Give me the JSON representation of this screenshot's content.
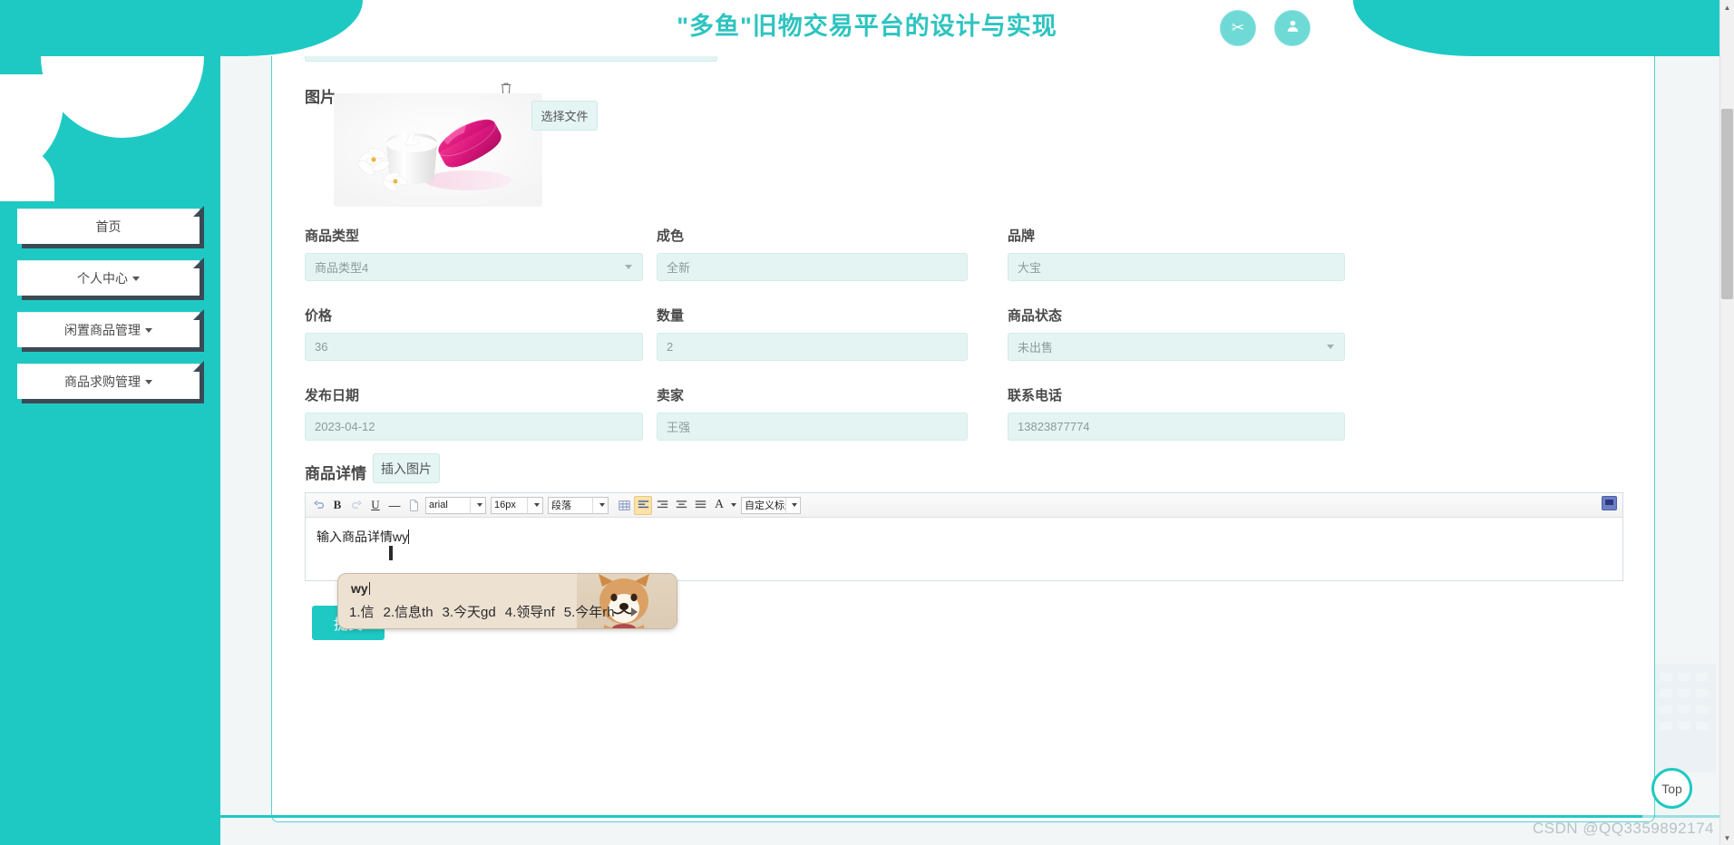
{
  "header": {
    "title": "\"多鱼\"旧物交易平台的设计与实现",
    "share_icon": "✂",
    "user_icon": "👤",
    "accent_color": "#1fc9c3"
  },
  "sidebar": {
    "items": [
      {
        "label": "首页",
        "has_caret": false
      },
      {
        "label": "个人中心",
        "has_caret": true
      },
      {
        "label": "闲置商品管理",
        "has_caret": true
      },
      {
        "label": "商品求购管理",
        "has_caret": true
      }
    ]
  },
  "form": {
    "image_section": {
      "label": "图片",
      "trash_icon": "🗑",
      "choose_file_label": "选择文件",
      "photo_alt": "cosmetic-cream-jar"
    },
    "rows": [
      {
        "fields": [
          {
            "label": "商品类型",
            "value": "商品类型4",
            "type": "select"
          },
          {
            "label": "成色",
            "value": "全新",
            "type": "text"
          },
          {
            "label": "品牌",
            "value": "大宝",
            "type": "text"
          }
        ]
      },
      {
        "fields": [
          {
            "label": "价格",
            "value": "36",
            "type": "text"
          },
          {
            "label": "数量",
            "value": "2",
            "type": "text"
          },
          {
            "label": "商品状态",
            "value": "未出售",
            "type": "select"
          }
        ]
      },
      {
        "fields": [
          {
            "label": "发布日期",
            "value": "2023-04-12",
            "type": "text"
          },
          {
            "label": "卖家",
            "value": "王强",
            "type": "text"
          },
          {
            "label": "联系电话",
            "value": "13823877774",
            "type": "text"
          }
        ]
      }
    ],
    "detail": {
      "label": "商品详情",
      "insert_image_label": "插入图片",
      "editor_text": "输入商品详情wy"
    },
    "submit_label": "提交"
  },
  "editor_toolbar": {
    "undo_icon": "↶",
    "bold_label": "B",
    "redo_icon": "↷",
    "underline_label": "U",
    "hr_icon": "—",
    "page_icon": "▯",
    "font_family": "arial",
    "font_size": "16px",
    "paragraph": "段落",
    "table_icon": "▦",
    "align_left_icon": "≡",
    "align_right_icon": "≡",
    "align_center_icon": "≡",
    "align_justify_icon": "≡",
    "text_color_label": "A",
    "custom_title": "自定义标题",
    "fullscreen_icon": "fullscreen-icon"
  },
  "ime": {
    "input": "wy",
    "candidates": [
      "1.信",
      "2.信息th",
      "3.今天gd",
      "4.领导nf",
      "5.今年rh"
    ],
    "next_page_icon": "▸"
  },
  "top_button": {
    "label": "Top"
  },
  "watermark": {
    "text": "CSDN @QQ3359892174"
  },
  "scrollbar": {
    "up_icon": "▲",
    "down_icon": "▼"
  }
}
